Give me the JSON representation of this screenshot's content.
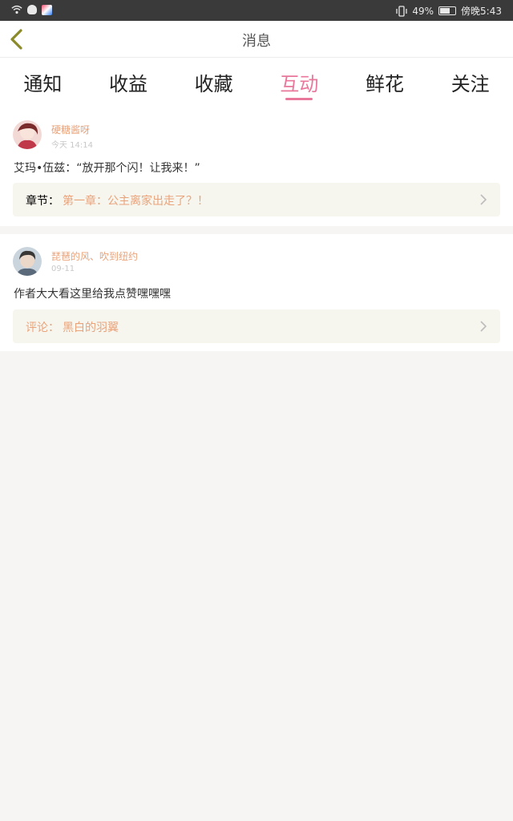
{
  "status": {
    "battery": "49%",
    "time": "傍晚5:43"
  },
  "header": {
    "title": "消息"
  },
  "tabs": [
    {
      "label": "通知"
    },
    {
      "label": "收益"
    },
    {
      "label": "收藏"
    },
    {
      "label": "互动"
    },
    {
      "label": "鲜花"
    },
    {
      "label": "关注"
    }
  ],
  "active_tab": "互动",
  "messages": [
    {
      "user": "硬糖酱呀",
      "time": "今天 14:14",
      "content": "艾玛•伍兹：“放开那个闪！让我来！”",
      "ref_label": "章节：",
      "ref_value": "第一章：公主离家出走了？！"
    },
    {
      "user": "琵琶的风、吹到纽约",
      "time": "09-11",
      "content": "作者大大看这里给我点赞嘿嘿嘿",
      "ref_label": "评论：",
      "ref_value": "黑白的羽翼"
    }
  ],
  "colors": {
    "accent": "#e8779b",
    "username": "#e9a37b",
    "ref_bg": "#f7f6ee",
    "page_bg": "#f7f5f4"
  }
}
